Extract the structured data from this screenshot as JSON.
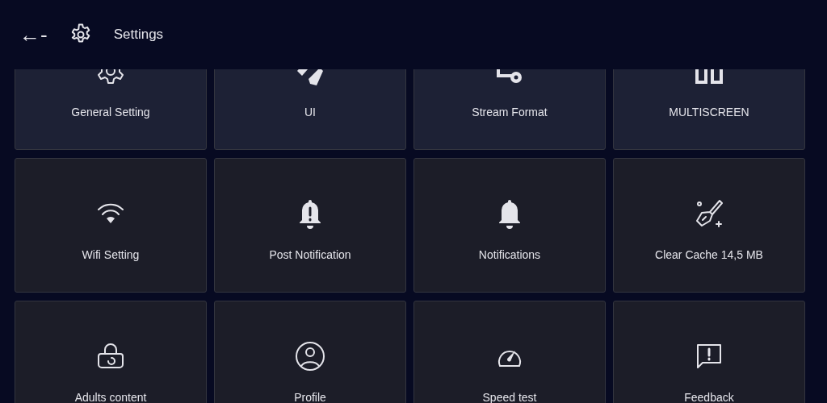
{
  "header": {
    "back": "←-",
    "title": "Settings"
  },
  "tiles": [
    {
      "label": "General Setting"
    },
    {
      "label": "UI"
    },
    {
      "label": "Stream Format"
    },
    {
      "label": "MULTISCREEN"
    },
    {
      "label": "Wifi Setting"
    },
    {
      "label": "Post Notification"
    },
    {
      "label": "Notifications"
    },
    {
      "label": "Clear Cache 14,5 MB"
    },
    {
      "label": "Adults content"
    },
    {
      "label": "Profile"
    },
    {
      "label": "Speed test"
    },
    {
      "label": "Feedback"
    }
  ]
}
